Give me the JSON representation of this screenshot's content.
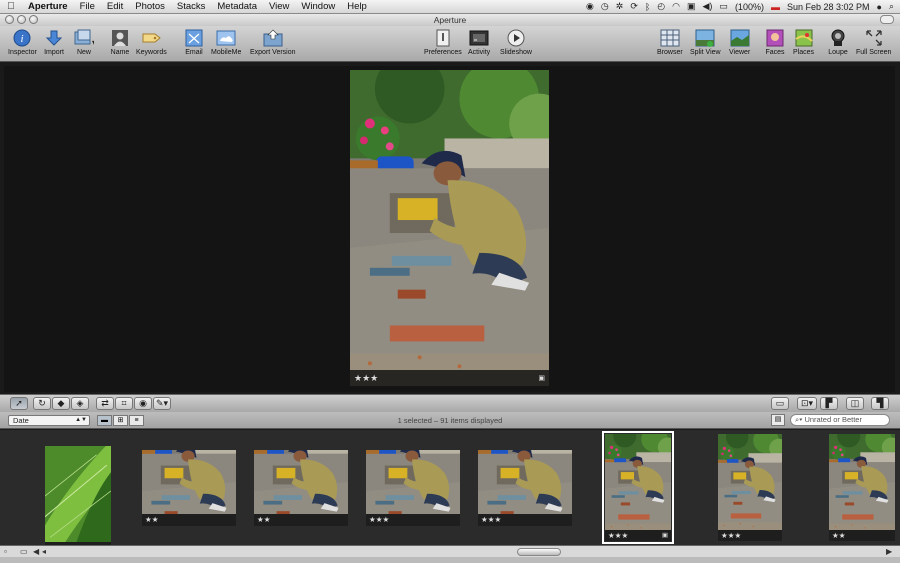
{
  "menubar": {
    "app": "Aperture",
    "items": [
      "File",
      "Edit",
      "Photos",
      "Stacks",
      "Metadata",
      "View",
      "Window",
      "Help"
    ],
    "battery": "(100%)",
    "clock": "Sun Feb 28  3:02 PM"
  },
  "window": {
    "title": "Aperture"
  },
  "toolbar": {
    "inspector": "Inspector",
    "import": "Import",
    "new": "New",
    "name": "Name",
    "keywords": "Keywords",
    "email": "Email",
    "mobileme": "MobileMe",
    "export_version": "Export Version",
    "preferences": "Preferences",
    "activity": "Activity",
    "slideshow": "Slideshow",
    "browser": "Browser",
    "split_view": "Split View",
    "viewer": "Viewer",
    "faces": "Faces",
    "places": "Places",
    "loupe": "Loupe",
    "full_screen": "Full Screen"
  },
  "viewer": {
    "rating": "★★★"
  },
  "browser": {
    "sort_by": "Date",
    "status": "1 selected – 91 items displayed",
    "filter": "Unrated or Better"
  },
  "thumbnails": [
    {
      "rating": ""
    },
    {
      "rating": "★★"
    },
    {
      "rating": "★★"
    },
    {
      "rating": "★★★"
    },
    {
      "rating": "★★★"
    },
    {
      "rating": "★★★"
    },
    {
      "rating": "★★★"
    },
    {
      "rating": "★★"
    }
  ],
  "colors": {
    "accent_blue": "#3a74c9",
    "viewer_bg": "#141414",
    "filmstrip_bg": "#2b2b2b"
  }
}
